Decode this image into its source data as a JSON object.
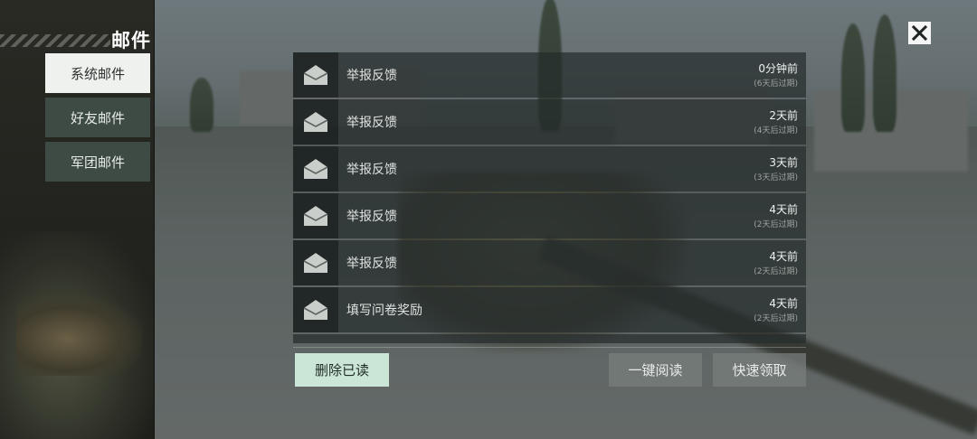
{
  "sidebar": {
    "title": "邮件",
    "tabs": [
      {
        "label": "系统邮件",
        "active": true
      },
      {
        "label": "好友邮件",
        "active": false
      },
      {
        "label": "军团邮件",
        "active": false
      }
    ]
  },
  "mails": [
    {
      "subject": "举报反馈",
      "time": "0分钟前",
      "expiry": "(6天后过期)",
      "icon": "envelope-icon"
    },
    {
      "subject": "举报反馈",
      "time": "2天前",
      "expiry": "(4天后过期)",
      "icon": "envelope-icon"
    },
    {
      "subject": "举报反馈",
      "time": "3天前",
      "expiry": "(3天后过期)",
      "icon": "envelope-icon"
    },
    {
      "subject": "举报反馈",
      "time": "4天前",
      "expiry": "(2天后过期)",
      "icon": "envelope-icon"
    },
    {
      "subject": "举报反馈",
      "time": "4天前",
      "expiry": "(2天后过期)",
      "icon": "envelope-icon"
    },
    {
      "subject": "填写问卷奖励",
      "time": "4天前",
      "expiry": "(2天后过期)",
      "icon": "envelope-icon"
    }
  ],
  "buttons": {
    "delete_read": "删除已读",
    "read_all": "一键阅读",
    "quick_collect": "快速领取"
  },
  "colors": {
    "active_tab": "#eef1ee",
    "inactive_tab": "#3d4b44",
    "primary_button": "#cbe6d6"
  }
}
